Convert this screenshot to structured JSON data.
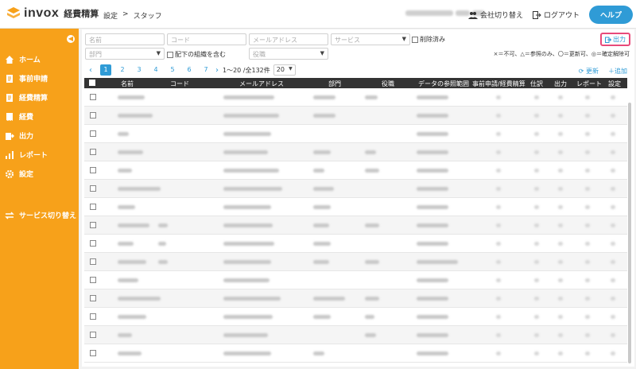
{
  "app": {
    "logo_text": "invox",
    "logo_sub": "経費精算",
    "breadcrumb": [
      "設定",
      ">",
      "スタッフ"
    ],
    "company_switch": "会社切り替え",
    "logout": "ログアウト",
    "help": "ヘルプ",
    "accent": "#f7a11a",
    "blue": "#2f9bd6"
  },
  "sidebar": {
    "items": [
      {
        "label": "ホーム",
        "icon": "home-icon"
      },
      {
        "label": "事前申請",
        "icon": "document-icon"
      },
      {
        "label": "経費精算",
        "icon": "document-icon"
      },
      {
        "label": "経費",
        "icon": "receipt-icon"
      },
      {
        "label": "出力",
        "icon": "export-icon"
      },
      {
        "label": "レポート",
        "icon": "report-icon"
      },
      {
        "label": "設定",
        "icon": "gear-icon"
      },
      {
        "label": "サービス切り替え",
        "icon": "switch-icon"
      }
    ]
  },
  "filters": {
    "name_placeholder": "名前",
    "code_placeholder": "コード",
    "email_placeholder": "メールアドレス",
    "service_placeholder": "サービス",
    "deleted_label": "削除済み",
    "dept_placeholder": "部門",
    "sub_org_label": "配下の組織を含む",
    "position_placeholder": "役職",
    "export_label": "出力",
    "legend": "×＝不可、△＝参照のみ、〇＝更新可、◎＝確定解除可"
  },
  "pager": {
    "pages": [
      "1",
      "2",
      "3",
      "4",
      "5",
      "6",
      "7"
    ],
    "count_text": "1〜20 /全132件",
    "per_page": "20",
    "refresh": "更新",
    "add": "追加"
  },
  "table": {
    "headers": [
      "名前",
      "コード",
      "メールアドレス",
      "部門",
      "役職",
      "データの参照範囲",
      "事前申請/経費精算",
      "仕訳",
      "出力",
      "レポート",
      "設定"
    ]
  }
}
